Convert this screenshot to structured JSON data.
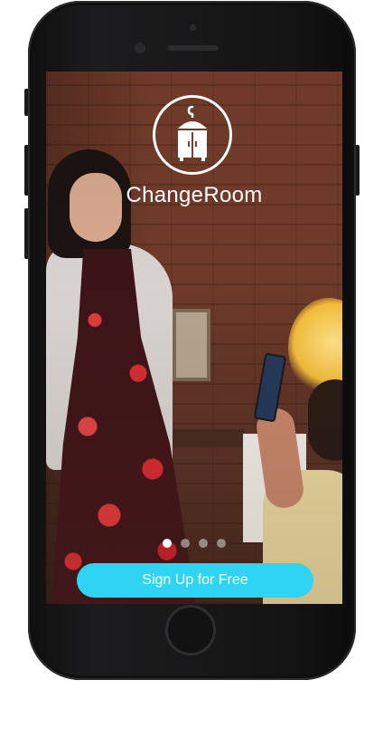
{
  "app": {
    "title": "ChangeRoom",
    "logo_icon": "dressing-room-wardrobe-icon"
  },
  "onboarding": {
    "page_count": 4,
    "active_page": 1,
    "cta_label": "Sign Up for Free"
  },
  "colors": {
    "cta_background": "#2fd4f5",
    "cta_text": "#ffffff",
    "title_text": "#ffffff",
    "dot_active": "#ffffff",
    "dot_inactive": "rgba(255,255,255,0.45)",
    "phone_body": "#1c1c1e"
  }
}
